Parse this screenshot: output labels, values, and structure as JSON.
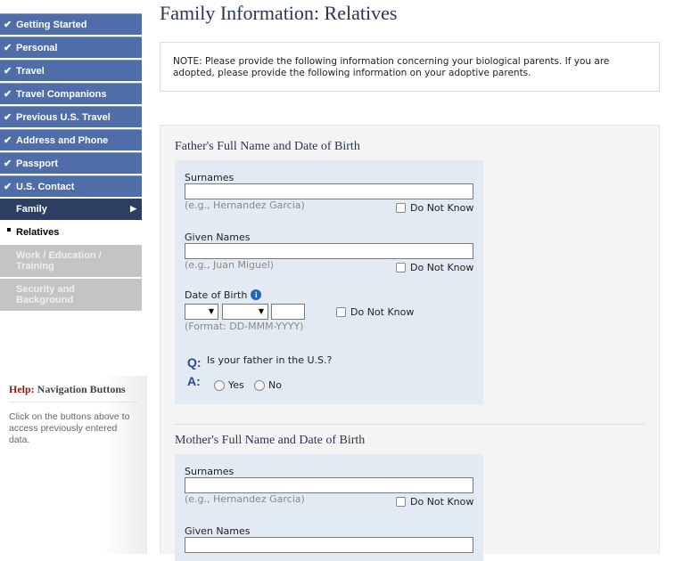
{
  "nav": {
    "completed": [
      "Getting Started",
      "Personal",
      "Travel",
      "Travel Companions",
      "Previous U.S. Travel",
      "Address and Phone",
      "Passport",
      "U.S. Contact"
    ],
    "current": "Family",
    "sub_current": "Relatives",
    "upcoming": [
      "Work / Education / Training",
      "Security and Background"
    ]
  },
  "help": {
    "label": "Help:",
    "title": "Navigation Buttons",
    "text": "Click on the buttons above to access previously entered data."
  },
  "page_title": "Family Information: Relatives",
  "note": "NOTE: Please provide the following information concerning your biological parents. If you are adopted, please provide the following information on your adoptive parents.",
  "father": {
    "section_title": "Father's Full Name and Date of Birth",
    "surnames_label": "Surnames",
    "surnames_value": "",
    "surnames_hint": "(e.g., Hernandez Garcia)",
    "given_label": "Given Names",
    "given_value": "",
    "given_hint": "(e.g., Juan Miguel)",
    "dob_label": "Date of Birth",
    "dob_hint": "(Format: DD-MMM-YYYY)",
    "dob_year": "",
    "do_not_know": "Do Not Know",
    "q_marker": "Q:",
    "question": "Is your father in the U.S.?",
    "a_marker": "A:",
    "yes": "Yes",
    "no": "No"
  },
  "mother": {
    "section_title": "Mother's Full Name and Date of Birth",
    "surnames_label": "Surnames",
    "surnames_value": "",
    "surnames_hint": "(e.g., Hernandez Garcia)",
    "given_label": "Given Names",
    "given_value": "",
    "do_not_know": "Do Not Know"
  },
  "icons": {
    "check": "✔",
    "arrow": "▶",
    "dropdown": "▼",
    "info": "i"
  },
  "colors": {
    "nav_done": "#4f6ea9",
    "nav_current": "#2c3f63",
    "nav_todo": "#c4c4c4",
    "panel": "#e2eaf4",
    "title": "#2a3550"
  }
}
